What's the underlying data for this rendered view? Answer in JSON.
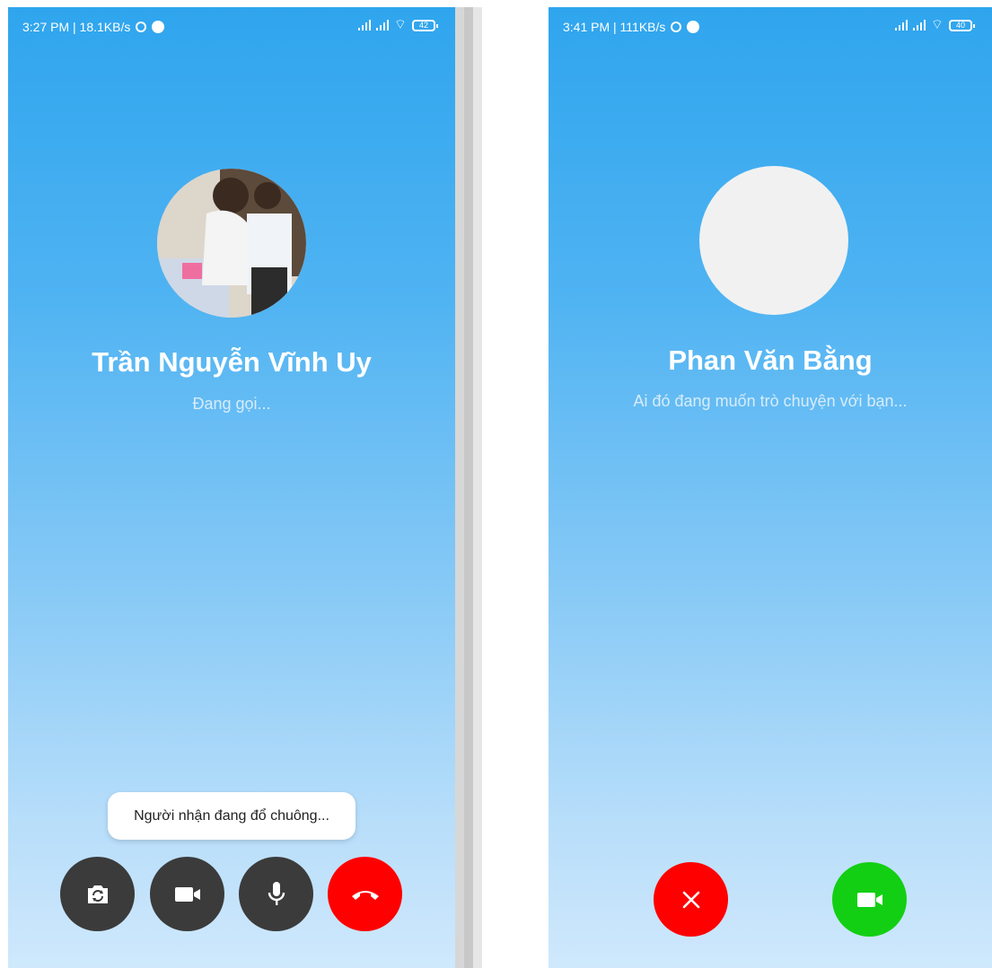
{
  "outgoing_call": {
    "status_bar": {
      "time_speed": "3:27 PM | 18.1KB/s",
      "battery": "42"
    },
    "caller_name": "Trần Nguyễn Vĩnh Uy",
    "call_status": "Đang gọi...",
    "toast": "Người nhận đang đổ chuông...",
    "buttons": [
      "switch-camera-icon",
      "video-camera-icon",
      "microphone-icon",
      "hang-up-icon"
    ],
    "colors": {
      "control": "#3b3b3b",
      "end_call": "#fe0000"
    }
  },
  "incoming_call": {
    "status_bar": {
      "time_speed": "3:41 PM | 111KB/s",
      "battery": "40"
    },
    "caller_name": "Phan Văn Bằng",
    "call_status": "Ai đó đang muốn trò chuyện với bạn...",
    "buttons": [
      "close-icon",
      "video-camera-icon"
    ],
    "colors": {
      "decline": "#fe0000",
      "accept": "#13cf13"
    }
  },
  "colors": {
    "gradient_top": "#2fa5ee",
    "gradient_bottom": "#cfe8fc"
  }
}
